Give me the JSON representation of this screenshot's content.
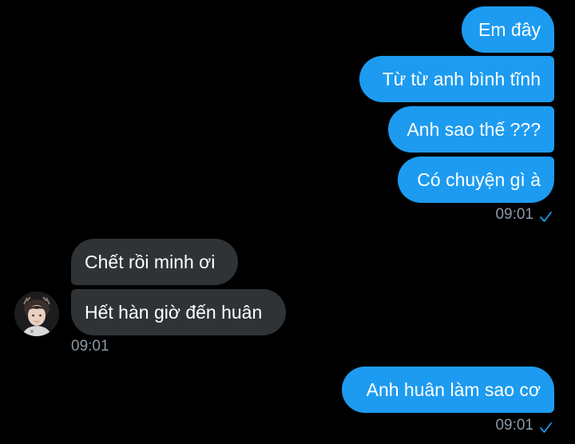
{
  "outgoing_group_1": {
    "messages": [
      "Em đây",
      "Từ từ anh bình tĩnh",
      "Anh sao thế ???",
      "Có chuyện gì à"
    ],
    "time": "09:01",
    "status_icon": "read-check-icon"
  },
  "incoming_group": {
    "messages": [
      "Chết rồi minh ơi",
      "Hết hàn giờ đến huân"
    ],
    "time": "09:01",
    "avatar_icon": "user-avatar"
  },
  "outgoing_group_2": {
    "messages": [
      "Anh huân làm sao cơ"
    ],
    "time": "09:01",
    "status_icon": "read-check-icon"
  },
  "colors": {
    "background": "#000000",
    "outgoing_bubble": "#1D9BF0",
    "incoming_bubble": "#2F3336",
    "timestamp": "#8B98A5",
    "check": "#1D9BF0"
  }
}
